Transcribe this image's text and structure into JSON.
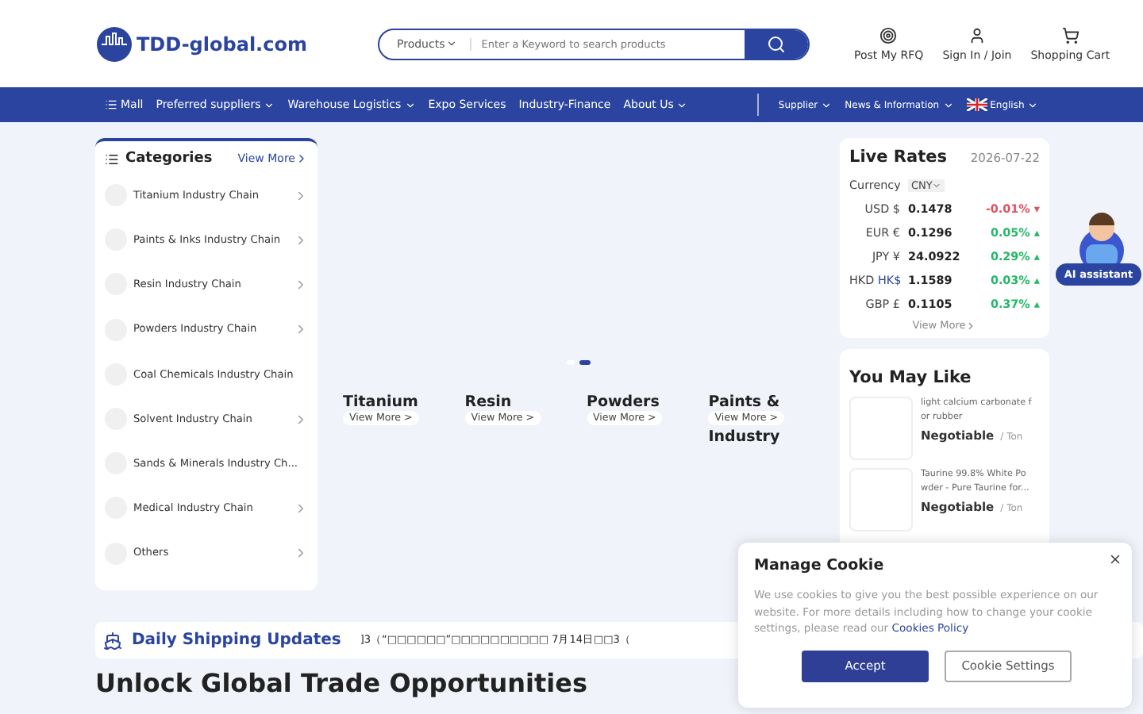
{
  "header": {
    "logo": "TDD-global.com",
    "search": {
      "category": "Products",
      "placeholder": "Enter a Keyword to search products"
    },
    "actions": [
      {
        "kind": "rfq",
        "label": "Post My RFQ"
      },
      {
        "kind": "user",
        "label": "Sign In / Join"
      },
      {
        "kind": "cart",
        "label": "Shopping Cart"
      }
    ]
  },
  "nav": {
    "left": [
      {
        "label": "Mall",
        "kind": "menu"
      },
      {
        "label": "Preferred suppliers",
        "kind": "dropdown"
      },
      {
        "label": "Warehouse Logistics",
        "kind": "dropdown"
      },
      {
        "label": "Expo Services",
        "kind": "plain"
      },
      {
        "label": "Industry-Finance",
        "kind": "plain"
      },
      {
        "label": "About Us",
        "kind": "dropdown"
      }
    ],
    "right": [
      {
        "label": "Supplier",
        "kind": "dropdown"
      },
      {
        "label": "News & Information",
        "kind": "dropdown"
      },
      {
        "label": "English",
        "kind": "language"
      }
    ]
  },
  "categories": {
    "title": "Categories",
    "view_more": "View More",
    "items": [
      {
        "label": "Titanium Industry Chain",
        "arrow": true
      },
      {
        "label": "Paints & Inks Industry Chain",
        "arrow": true
      },
      {
        "label": "Resin Industry Chain",
        "arrow": true
      },
      {
        "label": "Powders Industry Chain",
        "arrow": true
      },
      {
        "label": "Coal Chemicals Industry Chain",
        "arrow": false
      },
      {
        "label": "Solvent Industry Chain",
        "arrow": true
      },
      {
        "label": "Sands & Minerals Industry Ch...",
        "arrow": false
      },
      {
        "label": "Medical Industry Chain",
        "arrow": true
      },
      {
        "label": "Others",
        "arrow": true
      }
    ]
  },
  "carousel": {
    "dots": [
      {
        "selected": false
      },
      {
        "selected": true
      }
    ],
    "cards": [
      {
        "title": "Titanium",
        "button": "View More >"
      },
      {
        "title": "Resin",
        "button": "View More >"
      },
      {
        "title": "Powders",
        "button": "View More >"
      },
      {
        "title": "Paints &",
        "button": "View More >",
        "tail": "Industry"
      }
    ]
  },
  "live_rates": {
    "title": "Live Rates",
    "date": "2026-07-22",
    "currency_label": "Currency",
    "currency": "CNY",
    "rows": [
      {
        "code": "USD",
        "symbol": "$",
        "rate": "0.1478",
        "change": "-0.01%",
        "up": false,
        "arrow": "▾"
      },
      {
        "code": "EUR",
        "symbol": "€",
        "rate": "0.1296",
        "change": "0.05%",
        "up": true,
        "arrow": "▴"
      },
      {
        "code": "JPY",
        "symbol": "¥",
        "rate": "24.0922",
        "change": "0.29%",
        "up": true,
        "arrow": "▴"
      },
      {
        "code": "HKD",
        "symbol": "HK$",
        "rate": "1.1589",
        "change": "0.03%",
        "up": true,
        "arrow": "▴"
      },
      {
        "code": "GBP",
        "symbol": "£",
        "rate": "0.1105",
        "change": "0.37%",
        "up": true,
        "arrow": "▴"
      }
    ],
    "view_more": "View More"
  },
  "you_may_like": {
    "title": "You May Like",
    "items": [
      {
        "name": "light calcium carbonate f or rubber",
        "price": "Negotiable",
        "unit": "/ Ton"
      },
      {
        "name": "Taurine 99.8% White Po wder - Pure Taurine for...",
        "price": "Negotiable",
        "unit": "/ Ton"
      }
    ]
  },
  "assistant": {
    "label": "AI assistant"
  },
  "ticker": {
    "title": "Daily Shipping Updates",
    "text": "]3（“□□□□□□”□□□□□□□□□□ 7月14日□□3（"
  },
  "section": {
    "heading": "Unlock Global Trade Opportunities"
  },
  "cookie": {
    "title": "Manage Cookie",
    "text": "We use cookies to give you the best possible experience on our website. For more details including how to change your cookie settings, please read our",
    "link": "Cookies Policy",
    "accept": "Accept",
    "settings": "Cookie Settings"
  }
}
